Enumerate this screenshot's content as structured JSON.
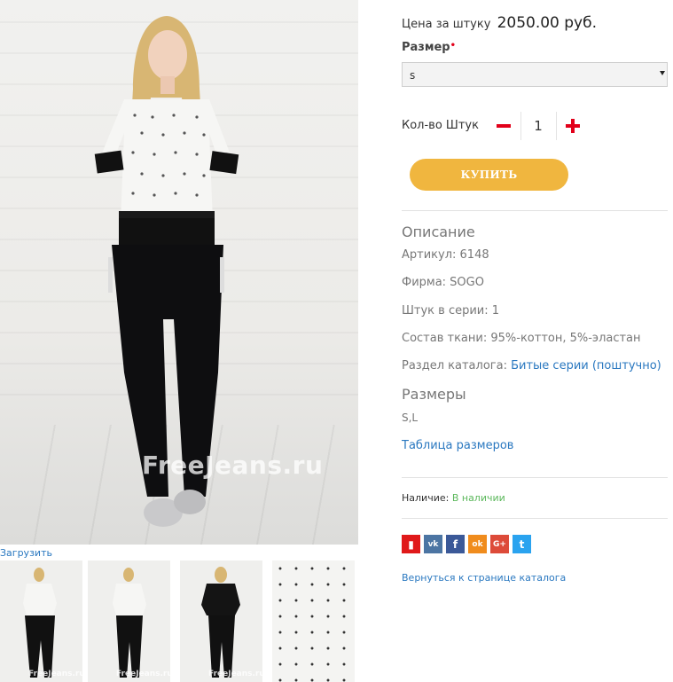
{
  "gallery": {
    "watermark": "FreeJeans.ru",
    "upload_label": "Загрузить",
    "thumb_watermark": "FreeJeans.ru"
  },
  "product": {
    "price_prefix": "Цена за штуку",
    "price_value": "2050.00 руб.",
    "size_label": "Размер",
    "size_required_mark": "•",
    "size_selected": "s",
    "qty_label": "Кол-во Штук",
    "qty_value": "1",
    "buy_label": "КУПИТЬ"
  },
  "description": {
    "title": "Описание",
    "article": "Артикул: 6148",
    "brand": "Фирма: SOGO",
    "series_count": "Штук в серии: 1",
    "fabric": "Состав ткани: 95%-коттон, 5%-эластан",
    "catalog_prefix": "Раздел каталога:",
    "catalog_link": "Битые серии (поштучно)"
  },
  "sizes": {
    "title": "Размеры",
    "values": "S,L",
    "table_link": "Таблица размеров"
  },
  "availability": {
    "label": "Наличие:",
    "value": "В наличии"
  },
  "share": {
    "icons": [
      {
        "name": "bookmark-icon",
        "glyph": "▮",
        "color": "#e0191a"
      },
      {
        "name": "vk-icon",
        "glyph": "vk",
        "color": "#4c75a3"
      },
      {
        "name": "facebook-icon",
        "glyph": "f",
        "color": "#3b5998"
      },
      {
        "name": "odnoklassniki-icon",
        "glyph": "ok",
        "color": "#f08c1d"
      },
      {
        "name": "google-plus-icon",
        "glyph": "G+",
        "color": "#dd4b39"
      },
      {
        "name": "twitter-icon",
        "glyph": "t",
        "color": "#2aa3ef"
      }
    ]
  },
  "back_link": "Вернуться к странице каталога",
  "colors": {
    "accent_red": "#e2001a",
    "buy_button": "#f0b63f",
    "link_blue": "#2a78c0",
    "in_stock_green": "#5cb85c"
  }
}
